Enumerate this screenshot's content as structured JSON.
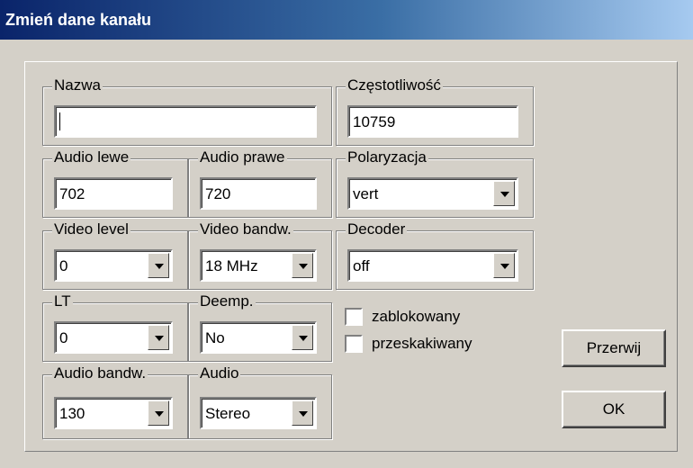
{
  "window": {
    "title": "Zmień dane kanału"
  },
  "groups": {
    "nazwa": {
      "label": "Nazwa",
      "value": ""
    },
    "czestotliwosc": {
      "label": "Częstotliwość",
      "value": "10759"
    },
    "audio_lewe": {
      "label": "Audio lewe",
      "value": "702"
    },
    "audio_prawe": {
      "label": "Audio prawe",
      "value": "720"
    },
    "polaryzacja": {
      "label": "Polaryzacja",
      "value": "vert"
    },
    "video_level": {
      "label": "Video level",
      "value": "0"
    },
    "video_bandw": {
      "label": "Video bandw.",
      "value": "18 MHz"
    },
    "decoder": {
      "label": "Decoder",
      "value": "off"
    },
    "lt": {
      "label": "LT",
      "value": "0"
    },
    "deemp": {
      "label": "Deemp.",
      "value": "No"
    },
    "audio_bandw": {
      "label": "Audio bandw.",
      "value": "130"
    },
    "audio": {
      "label": "Audio",
      "value": "Stereo"
    }
  },
  "checkboxes": {
    "zablokowany": {
      "label": "zablokowany",
      "checked": false
    },
    "przeskakiwany": {
      "label": "przeskakiwany",
      "checked": false
    }
  },
  "buttons": {
    "cancel": "Przerwij",
    "ok": "OK"
  }
}
